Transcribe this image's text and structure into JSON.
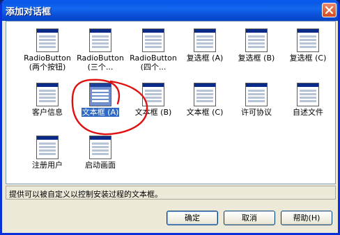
{
  "window": {
    "title": "添加对话框"
  },
  "items": [
    {
      "label": "RadioButton",
      "sub": "(两个按钮)"
    },
    {
      "label": "RadioButton",
      "sub": "(三个..."
    },
    {
      "label": "RadioButton",
      "sub": "(四个..."
    },
    {
      "label": "复选框  (A)",
      "sub": ""
    },
    {
      "label": "复选框  (B)",
      "sub": ""
    },
    {
      "label": "复选框  (C)",
      "sub": ""
    },
    {
      "label": "客户信息",
      "sub": ""
    },
    {
      "label": "文本框  (A)",
      "sub": "",
      "selected": true
    },
    {
      "label": "文本框  (B)",
      "sub": ""
    },
    {
      "label": "文本框  (C)",
      "sub": ""
    },
    {
      "label": "许可协议",
      "sub": ""
    },
    {
      "label": "自述文件",
      "sub": ""
    },
    {
      "label": "注册用户",
      "sub": ""
    },
    {
      "label": "启动画面",
      "sub": ""
    }
  ],
  "status": {
    "text": "提供可以被自定义以控制安装过程的文本框。"
  },
  "buttons": {
    "ok": "确定",
    "cancel": "取消",
    "help": "帮助(H)"
  },
  "colors": {
    "selection": "#316ac5",
    "annotation": "#e01010",
    "title_bar": "#0a58e6"
  }
}
